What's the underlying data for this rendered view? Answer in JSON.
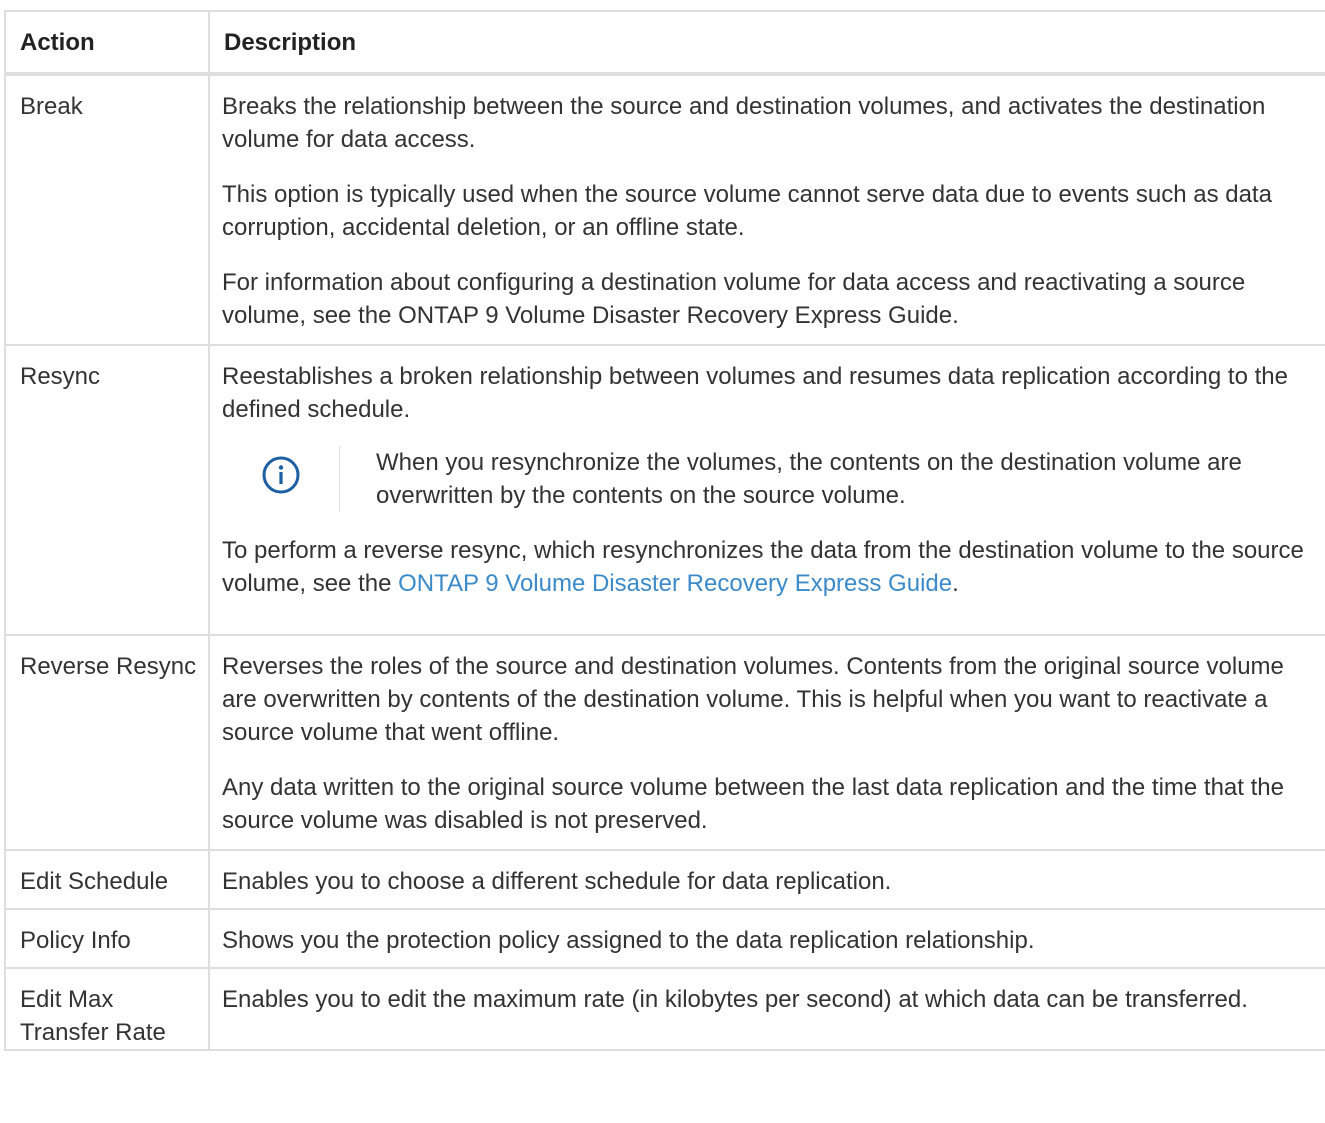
{
  "headers": {
    "action": "Action",
    "description": "Description"
  },
  "rows": [
    {
      "action": "Break",
      "paragraphs": [
        "Breaks the relationship between the source and destination volumes, and activates the destination volume for data access.",
        "This option is typically used when the source volume cannot serve data due to events such as data corruption, accidental deletion, or an offline state.",
        "For information about configuring a destination volume for data access and reactivating a source volume, see the ONTAP 9 Volume Disaster Recovery Express Guide."
      ]
    },
    {
      "action": "Resync",
      "paragraphs": [
        "Reestablishes a broken relationship between volumes and resumes data replication according to the defined schedule."
      ],
      "note": {
        "icon": "info-icon",
        "text": "When you resynchronize the volumes, the contents on the destination volume are overwritten by the contents on the source volume."
      },
      "after_note": {
        "text_before_link": "To perform a reverse resync, which resynchronizes the data from the destination volume to the source volume, see the ",
        "link_text": "ONTAP 9 Volume Disaster Recovery Express Guide",
        "text_after_link": "."
      }
    },
    {
      "action": "Reverse Resync",
      "paragraphs": [
        "Reverses the roles of the source and destination volumes. Contents from the original source volume are overwritten by contents of the destination volume. This is helpful when you want to reactivate a source volume that went offline.",
        "Any data written to the original source volume between the last data replication and the time that the source volume was disabled is not preserved."
      ]
    },
    {
      "action": "Edit Schedule",
      "paragraphs": [
        "Enables you to choose a different schedule for data replication."
      ]
    },
    {
      "action": "Policy Info",
      "paragraphs": [
        "Shows you the protection policy assigned to the data replication relationship."
      ]
    },
    {
      "action": "Edit Max Transfer Rate",
      "paragraphs": [
        "Enables you to edit the maximum rate (in kilobytes per second) at which data can be transferred."
      ]
    }
  ],
  "colors": {
    "border": "#dedede",
    "link": "#3b8ac9",
    "text": "#333333",
    "icon": "#1c5fa4"
  }
}
